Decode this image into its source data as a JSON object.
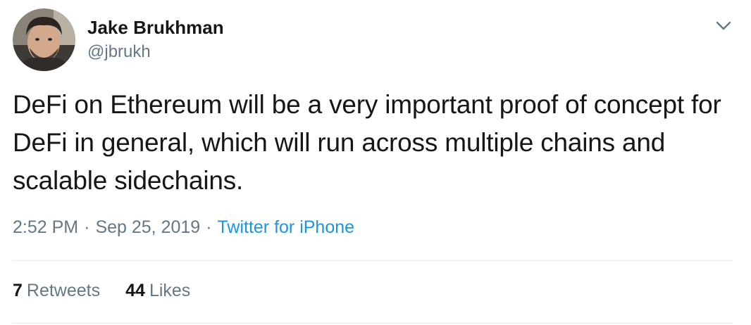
{
  "author": {
    "name": "Jake Brukhman",
    "handle": "@jbrukh"
  },
  "tweet": {
    "text": "DeFi on Ethereum will be a very important proof of concept for DeFi in general, which will run across multiple chains and scalable sidechains."
  },
  "meta": {
    "time": "2:52 PM",
    "separator": "·",
    "date": "Sep 25, 2019",
    "source": "Twitter for iPhone"
  },
  "stats": {
    "retweets_count": "7",
    "retweets_label": "Retweets",
    "likes_count": "44",
    "likes_label": "Likes"
  },
  "icons": {
    "menu": "chevron-down-icon"
  },
  "colors": {
    "text": "#14171a",
    "secondary": "#657786",
    "link": "#1b95e0",
    "divider": "#e6ecf0"
  }
}
